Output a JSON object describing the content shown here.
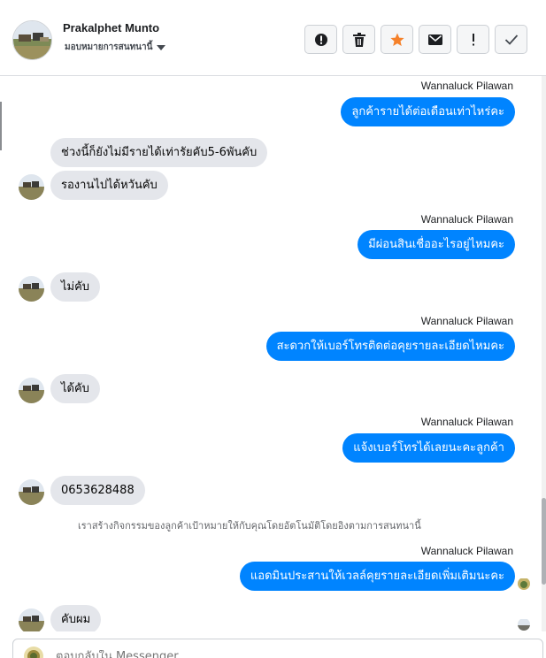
{
  "header": {
    "contact_name": "Prakalphet Munto",
    "assign_label": "มอบหมายการสนทนานี้",
    "actions": [
      "mark-spam",
      "delete",
      "star",
      "mark-unread",
      "follow-up",
      "done"
    ]
  },
  "messages": {
    "out1": {
      "sender": "Wannaluck Pilawan",
      "text": "ลูกค้ารายได้ต่อเดือนเท่าไหร่คะ"
    },
    "in1": {
      "text": "ช่วงนี้ก็ยังไม่มีรายได้เท่ารัยคับ5-6พันคับ"
    },
    "in2": {
      "text": "รองานไปได้หวันคับ"
    },
    "out2": {
      "sender": "Wannaluck Pilawan",
      "text": "มีผ่อนสินเชื่ออะไรอยู่ไหมคะ"
    },
    "in3": {
      "text": "ไม่คับ"
    },
    "out3": {
      "sender": "Wannaluck Pilawan",
      "text": "สะดวกให้เบอร์โทรติดต่อคุยรายละเอียดไหมคะ"
    },
    "in4": {
      "text": "ได้คับ"
    },
    "out4": {
      "sender": "Wannaluck Pilawan",
      "text": "แจ้งเบอร์โทรได้เลยนะคะลูกค้า"
    },
    "in5": {
      "text": "0653628488"
    },
    "system": "เราสร้างกิจกรรมของลูกค้าเป้าหมายให้กับคุณโดยอัตโนมัติโดยอิงตามการสนทนานี้",
    "out5": {
      "sender": "Wannaluck Pilawan",
      "text": "แอดมินประสานให้เวลล์คุยรายละเอียดเพิ่มเติมนะคะ"
    },
    "in6": {
      "text": "คับผม"
    }
  },
  "composer": {
    "placeholder": "ตอบกลับใน Messenger..."
  },
  "scroll": {
    "position": 0.9
  },
  "colors": {
    "outgoing": "#0084ff",
    "incoming": "#e4e6eb",
    "star": "#f5812a"
  }
}
